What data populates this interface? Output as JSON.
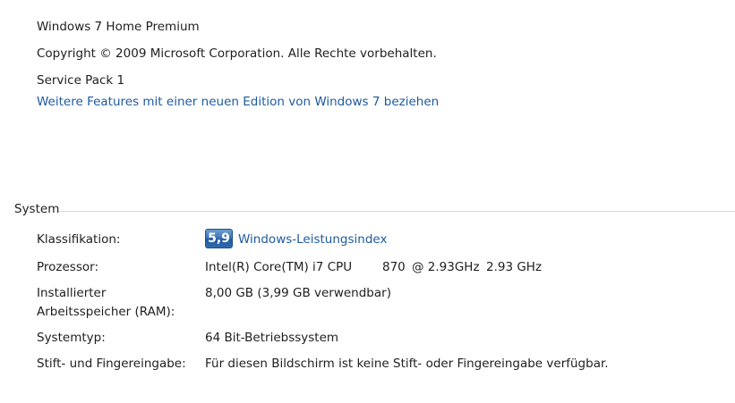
{
  "edition": {
    "name": "Windows 7 Home Premium",
    "copyright": "Copyright © 2009 Microsoft Corporation. Alle Rechte vorbehalten.",
    "service_pack": "Service Pack 1",
    "upgrade_link": "Weitere Features mit einer neuen Edition von Windows 7 beziehen"
  },
  "system": {
    "header": "System",
    "rating": {
      "label": "Klassifikation:",
      "score": "5,9",
      "link": "Windows-Leistungsindex"
    },
    "processor": {
      "label": "Prozessor:",
      "name": "Intel(R) Core(TM) i7 CPU",
      "model": "870",
      "clock": "@ 2.93GHz",
      "speed": "2.93 GHz"
    },
    "ram": {
      "label": "Installierter Arbeitsspeicher (RAM):",
      "value": "8,00 GB (3,99 GB verwendbar)"
    },
    "system_type": {
      "label": "Systemtyp:",
      "value": "64 Bit-Betriebssystem"
    },
    "pen_touch": {
      "label": "Stift- und Fingereingabe:",
      "value": "Für diesen Bildschirm ist keine Stift- oder Fingereingabe verfügbar."
    }
  },
  "colors": {
    "link": "#1e5a9e",
    "text": "#1e1e1e",
    "rule": "#d9d9d9"
  }
}
